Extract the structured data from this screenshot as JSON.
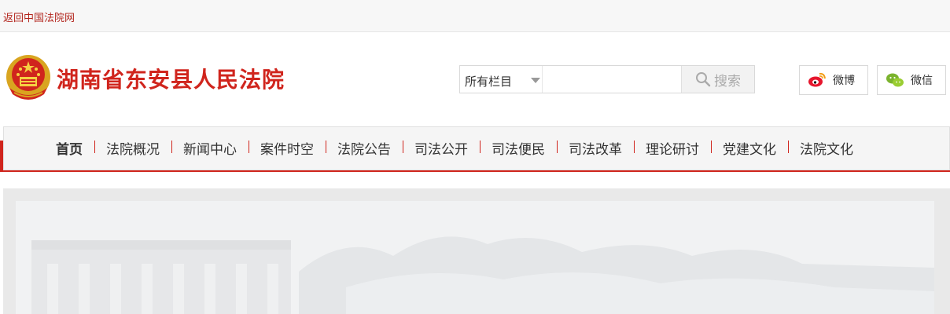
{
  "topbar": {
    "back_link": "返回中国法院网"
  },
  "header": {
    "title": "湖南省东安县人民法院",
    "emblem_icon": "national-emblem-icon",
    "brand_color": "#d0251d"
  },
  "search": {
    "select_label": "所有栏目",
    "input_value": "",
    "button_label": "搜索"
  },
  "social": {
    "weibo_label": "微博",
    "wechat_label": "微信"
  },
  "nav": {
    "items": [
      {
        "label": "首页"
      },
      {
        "label": "法院概况"
      },
      {
        "label": "新闻中心"
      },
      {
        "label": "案件时空"
      },
      {
        "label": "法院公告"
      },
      {
        "label": "司法公开"
      },
      {
        "label": "司法便民"
      },
      {
        "label": "司法改革"
      },
      {
        "label": "理论研讨"
      },
      {
        "label": "党建文化"
      },
      {
        "label": "法院文化"
      }
    ]
  }
}
